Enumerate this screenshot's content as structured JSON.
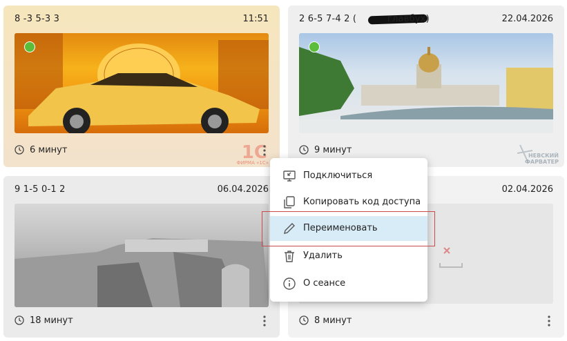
{
  "sessions": [
    {
      "code": "8  -3  5-3  3",
      "time": "11:51",
      "duration": "6 минут",
      "online": true
    },
    {
      "code": "2  6-5  7-4  2 (",
      "code_suffix": "главбух)",
      "time": "22.04.2026",
      "duration": "9 минут",
      "online": true
    },
    {
      "code": "9  1-5  0-1  2",
      "time": "06.04.2026",
      "duration": "18 минут",
      "online": false
    },
    {
      "code": "",
      "time": "02.04.2026",
      "duration": "8 минут",
      "online": false
    }
  ],
  "watermarks": {
    "c1_main": "1С",
    "c1_sub": "ФИРМА «1С»",
    "c2_main": "НЕВСКИЙ",
    "c2_sub": "ФАРВАТЕР"
  },
  "context_menu": {
    "items": [
      {
        "label": "Подключиться",
        "icon": "monitor-connect-icon"
      },
      {
        "label": "Копировать код доступа",
        "icon": "copy-icon"
      },
      {
        "label": "Переименовать",
        "icon": "pencil-icon"
      },
      {
        "label": "Удалить",
        "icon": "trash-icon"
      },
      {
        "label": "О сеансе",
        "icon": "info-icon"
      }
    ],
    "active_index": 2
  },
  "colors": {
    "online": "#5cbd3b",
    "menu_hover": "#d8ecf8",
    "highlight_border": "#c94a4a",
    "watermark": "#e23b2b"
  }
}
